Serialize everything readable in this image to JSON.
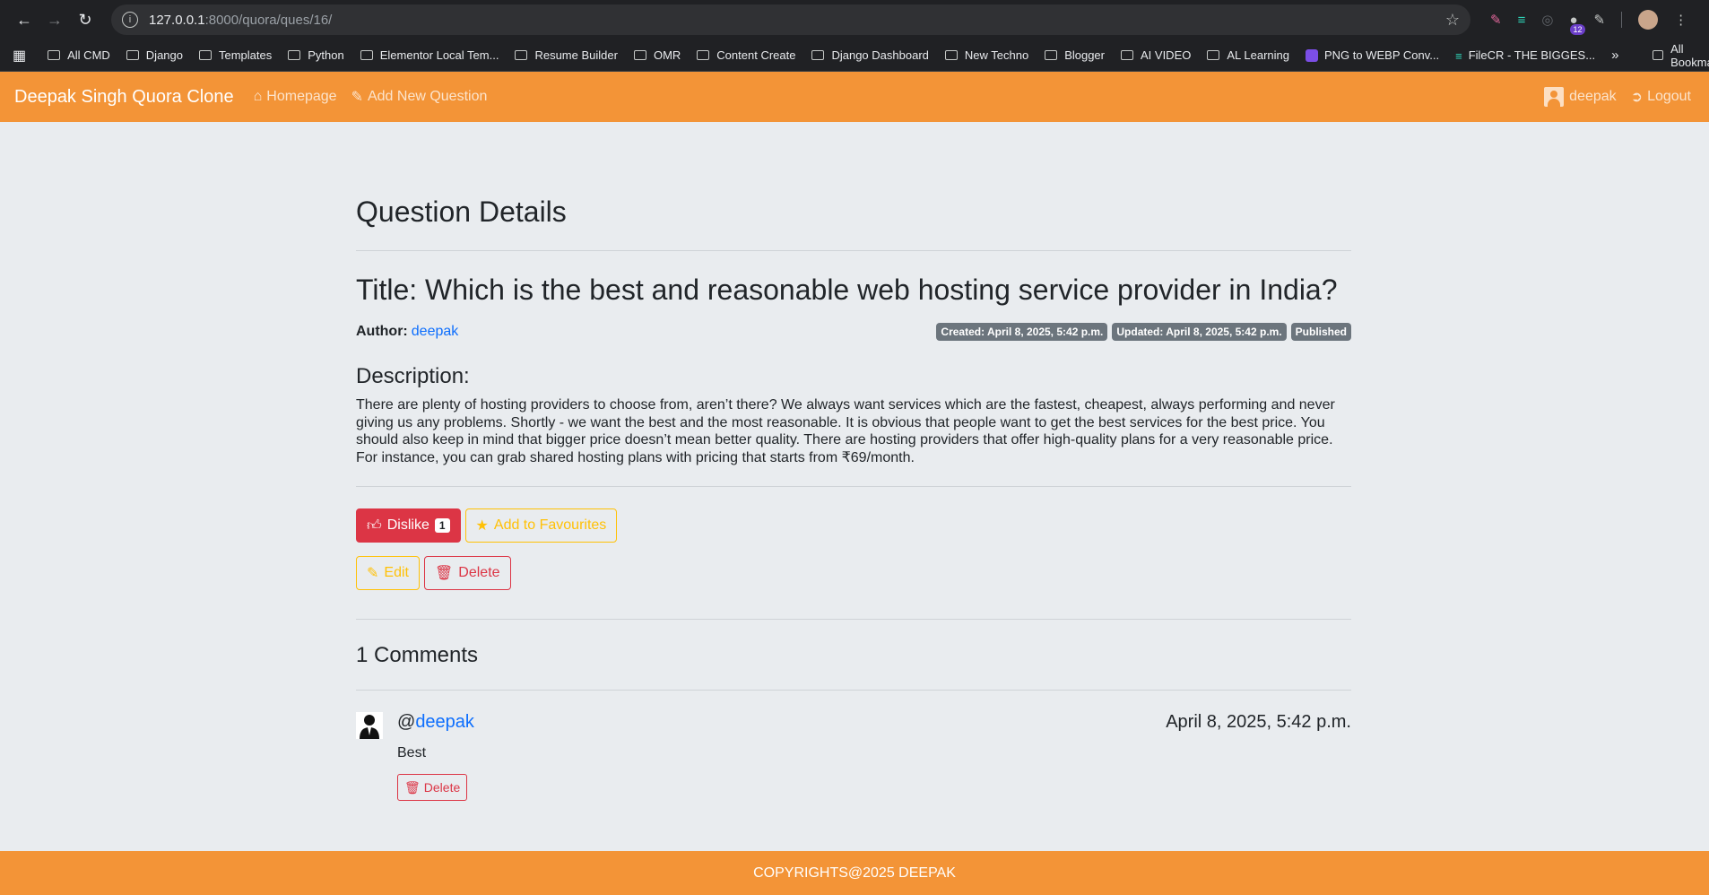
{
  "browser": {
    "url_host": "127.0.0.1",
    "url_path": ":8000/quora/ques/16/",
    "extension_badge": "12",
    "bookmarks": [
      {
        "label": "All CMD",
        "type": "folder"
      },
      {
        "label": "Django",
        "type": "folder"
      },
      {
        "label": "Templates",
        "type": "folder"
      },
      {
        "label": "Python",
        "type": "folder"
      },
      {
        "label": "Elementor Local Tem...",
        "type": "folder"
      },
      {
        "label": "Resume Builder",
        "type": "folder"
      },
      {
        "label": "OMR",
        "type": "folder"
      },
      {
        "label": "Content Create",
        "type": "folder"
      },
      {
        "label": "Django Dashboard",
        "type": "folder"
      },
      {
        "label": "New Techno",
        "type": "folder"
      },
      {
        "label": "Blogger",
        "type": "folder"
      },
      {
        "label": "AI VIDEO",
        "type": "folder"
      },
      {
        "label": "AL Learning",
        "type": "folder"
      },
      {
        "label": "PNG to WEBP Conv...",
        "type": "site"
      },
      {
        "label": "FileCR - THE BIGGES...",
        "type": "filecr"
      }
    ],
    "all_bookmarks": "All Bookmarks"
  },
  "navbar": {
    "brand": "Deepak Singh Quora Clone",
    "homepage": "Homepage",
    "add_question": "Add New Question",
    "username": "deepak",
    "logout": "Logout"
  },
  "question": {
    "page_title": "Question Details",
    "title": "Title: Which is the best and reasonable web hosting service provider in India?",
    "author_label": "Author:",
    "author": "deepak",
    "created": "Created: April 8, 2025, 5:42 p.m.",
    "updated": "Updated: April 8, 2025, 5:42 p.m.",
    "status": "Published",
    "description_heading": "Description:",
    "description": "There are plenty of hosting providers to choose from, aren’t there? We always want services which are the fastest, cheapest, always performing and never giving us any problems. Shortly - we want the best and the most reasonable. It is obvious that people want to get the best services for the best price. You should also keep in mind that bigger price doesn’t mean better quality. There are hosting providers that offer high-quality plans for a very reasonable price. For instance, you can grab shared hosting plans with pricing that starts from ₹69/month."
  },
  "actions": {
    "dislike": "Dislike",
    "dislike_count": "1",
    "favourite": "Add to Favourites",
    "edit": "Edit",
    "delete": "Delete"
  },
  "comments": {
    "heading": "1 Comments",
    "items": [
      {
        "at": "@",
        "user": "deepak",
        "date": "April 8, 2025, 5:42 p.m.",
        "text": "Best",
        "delete": "Delete"
      }
    ]
  },
  "footer": {
    "text": "COPYRIGHTS@2025 DEEPAK"
  },
  "colors": {
    "primary": "#f39437",
    "danger": "#dc3545",
    "warning": "#ffc107",
    "link": "#0d6efd"
  }
}
